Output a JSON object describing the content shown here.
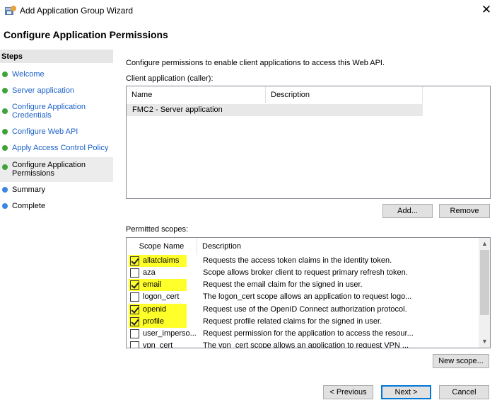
{
  "window": {
    "title": "Add Application Group Wizard",
    "close_glyph": "✕",
    "icon": "app-group-icon"
  },
  "page_heading": "Configure Application Permissions",
  "steps": {
    "title": "Steps",
    "items": [
      {
        "label": "Welcome",
        "state": "done"
      },
      {
        "label": "Server application",
        "state": "done"
      },
      {
        "label": "Configure Application Credentials",
        "state": "done"
      },
      {
        "label": "Configure Web API",
        "state": "done"
      },
      {
        "label": "Apply Access Control Policy",
        "state": "done"
      },
      {
        "label": "Configure Application Permissions",
        "state": "current"
      },
      {
        "label": "Summary",
        "state": "pending"
      },
      {
        "label": "Complete",
        "state": "pending"
      }
    ]
  },
  "main": {
    "intro": "Configure permissions to enable client applications to access this Web API.",
    "client_label": "Client application (caller):",
    "client_columns": [
      "Name",
      "Description"
    ],
    "client_rows": [
      {
        "name": "FMC2 - Server application",
        "description": ""
      }
    ],
    "add_button": "Add...",
    "remove_button": "Remove",
    "scopes_label": "Permitted scopes:",
    "scope_columns": [
      "Scope Name",
      "Description"
    ],
    "scopes": [
      {
        "name": "allatclaims",
        "checked": true,
        "description": "Requests the access token claims in the identity token."
      },
      {
        "name": "aza",
        "checked": false,
        "description": "Scope allows broker client to request primary refresh token."
      },
      {
        "name": "email",
        "checked": true,
        "description": "Request the email claim for the signed in user."
      },
      {
        "name": "logon_cert",
        "checked": false,
        "description": "The logon_cert scope allows an application to request logo..."
      },
      {
        "name": "openid",
        "checked": true,
        "description": "Request use of the OpenID Connect authorization protocol."
      },
      {
        "name": "profile",
        "checked": true,
        "description": "Request profile related claims for the signed in user."
      },
      {
        "name": "user_imperso...",
        "checked": false,
        "description": "Request permission for the application to access the resour..."
      },
      {
        "name": "vpn_cert",
        "checked": false,
        "description": "The vpn_cert scope allows an application to request VPN ..."
      }
    ],
    "highlight_color": "#ffff29",
    "new_scope_button": "New scope..."
  },
  "footer": {
    "previous_button": "< Previous",
    "next_button": "Next >",
    "cancel_button": "Cancel"
  },
  "colors": {
    "link": "#1960c9",
    "step_done": "#3ea33a",
    "step_pending": "#3a86e0",
    "default_button_border": "#0078d7"
  }
}
